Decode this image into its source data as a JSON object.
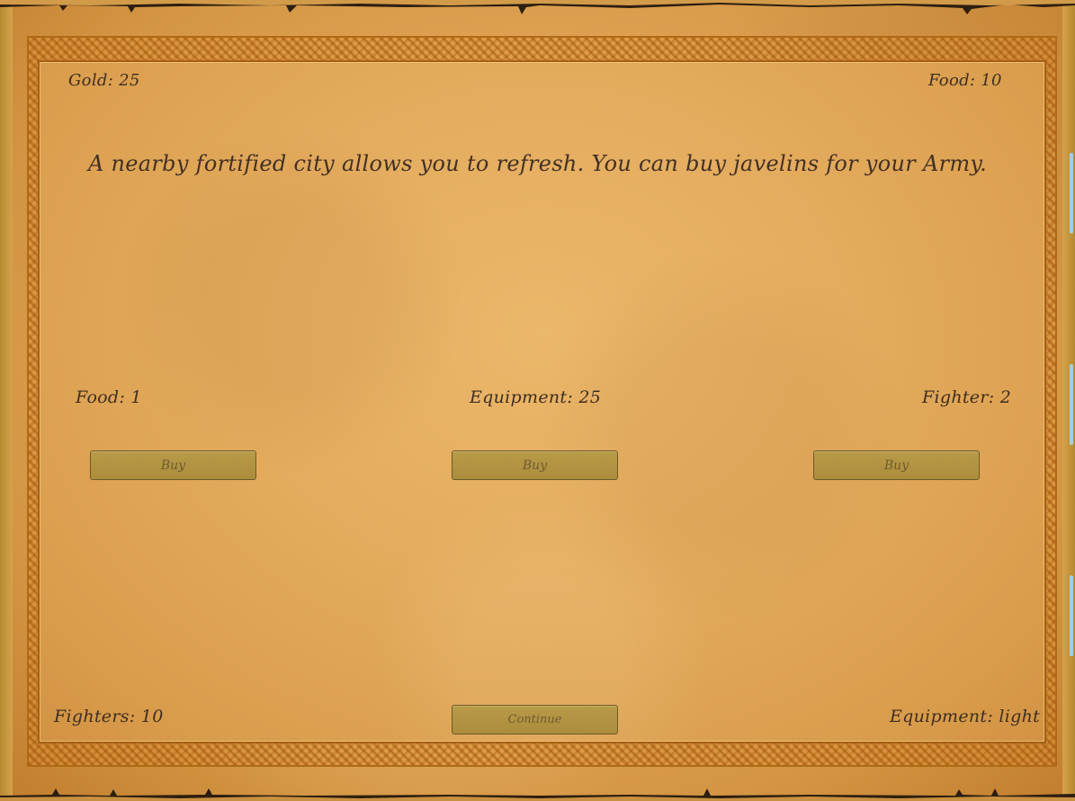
{
  "hud": {
    "gold": "Gold: 25",
    "food": "Food: 10",
    "fighters": "Fighters: 10",
    "equipment": "Equipment: light"
  },
  "event": {
    "message": "A nearby fortified city allows you to refresh. You can buy javelins for your Army."
  },
  "shop": {
    "items": [
      {
        "label": "Food: 1",
        "button": "Buy"
      },
      {
        "label": "Equipment: 25",
        "button": "Buy"
      },
      {
        "label": "Fighter: 2",
        "button": "Buy"
      }
    ]
  },
  "actions": {
    "continue": "Continue"
  },
  "colors": {
    "parchment": "#e4ab5d",
    "border": "#b06a16",
    "button": "#b09344",
    "ink": "#3d2e22",
    "side_accent": "#9fd0e6"
  }
}
